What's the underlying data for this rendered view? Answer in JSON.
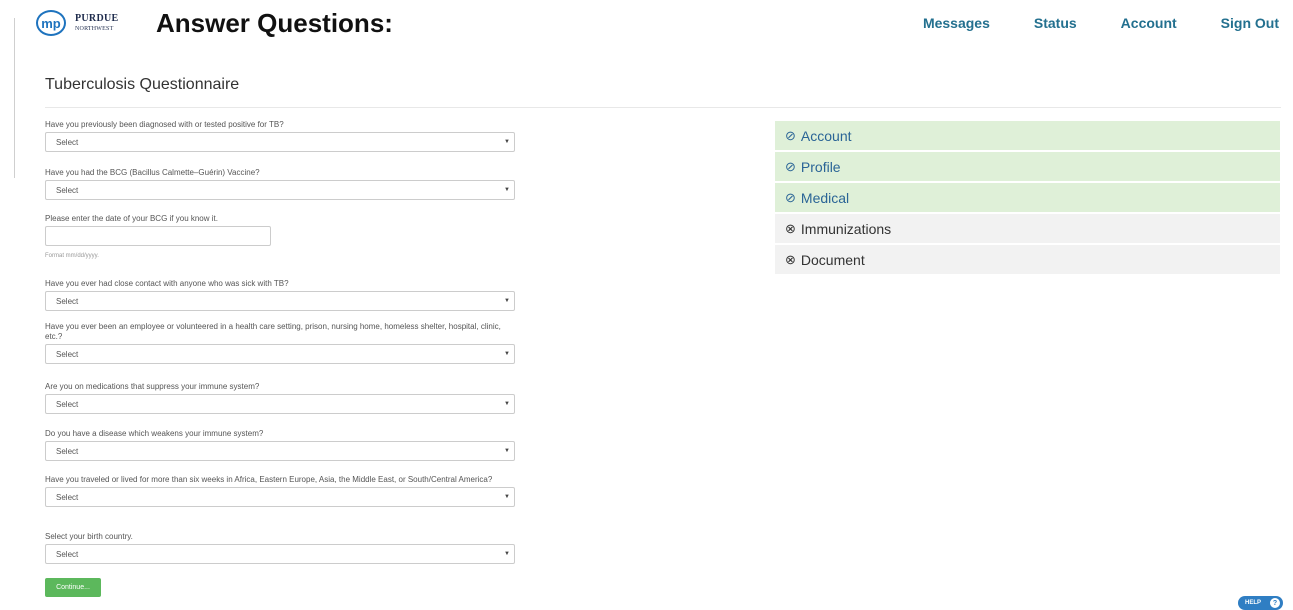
{
  "header": {
    "logo_mark": "mp",
    "logo_line1": "Purdue",
    "logo_line2": "Northwest",
    "banner_title": "Answer Questions:",
    "nav": [
      "Messages",
      "Status",
      "Account",
      "Sign Out"
    ]
  },
  "page_title": "Tuberculosis Questionnaire",
  "questions": [
    {
      "label": "Have you previously been diagnosed with or tested positive for TB?",
      "value": "Select"
    },
    {
      "label": "Have you had the BCG (Bacillus Calmette–Guérin) Vaccine?",
      "value": "Select"
    },
    {
      "label": "Please enter the date of your BCG if you know it.",
      "value": "",
      "hint": "Format mm/dd/yyyy."
    },
    {
      "label": "Have you ever had close contact with anyone who was sick with TB?",
      "value": "Select"
    },
    {
      "label": "Have you ever been an employee or volunteered in a health care setting, prison, nursing home, homeless shelter, hospital, clinic, etc.?",
      "value": "Select"
    },
    {
      "label": "Are you on medications that suppress your immune system?",
      "value": "Select"
    },
    {
      "label": "Do you have a disease which weakens your immune system?",
      "value": "Select"
    },
    {
      "label": "Have you traveled or lived for more than six weeks in Africa, Eastern Europe, Asia, the Middle East, or South/Central America?",
      "value": "Select"
    },
    {
      "label": "Select your birth country.",
      "value": "Select"
    }
  ],
  "caret_glyph": "▼",
  "continue_label": "Continue...",
  "steps": [
    {
      "label": "Account",
      "status": "complete",
      "icon": "check-circle-icon",
      "glyph": "⊘"
    },
    {
      "label": "Profile",
      "status": "complete",
      "icon": "check-circle-icon",
      "glyph": "⊘"
    },
    {
      "label": "Medical",
      "status": "complete",
      "icon": "check-circle-icon",
      "glyph": "⊘"
    },
    {
      "label": "Immunizations",
      "status": "incomplete",
      "icon": "x-circle-icon",
      "glyph": "⊗"
    },
    {
      "label": "Document",
      "status": "incomplete",
      "icon": "x-circle-icon",
      "glyph": "⊗"
    }
  ],
  "help": {
    "label": "HELP",
    "glyph": "?"
  },
  "colors": {
    "complete_bg": "#dff0d8",
    "incomplete_bg": "#f2f2f2",
    "link": "#23708f",
    "button": "#5cb85c"
  }
}
